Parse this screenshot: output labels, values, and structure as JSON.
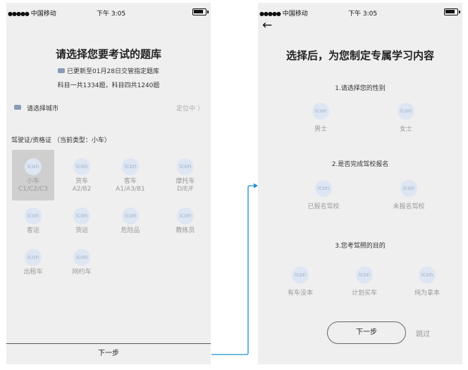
{
  "status_bar": {
    "signal_dots": "●●●●●",
    "carrier": "中国移动",
    "time": "下午 3:05"
  },
  "left_screen": {
    "title": "请选择您要考试的题库",
    "update_text": "已更新至01月28日交管指定题库",
    "total_text": "科目一共1334题，科目四共1240题",
    "city_label": "请选择城市",
    "locate_text": "定位中 〉",
    "license_section_title": "驾驶证/资格证 （当前类型：小车）",
    "categories": [
      {
        "icon": "icon",
        "name": "小车",
        "sub": "C1/C2/C3",
        "selected": true
      },
      {
        "icon": "icon",
        "name": "货车",
        "sub": "A2/B2"
      },
      {
        "icon": "icon",
        "name": "客车",
        "sub": "A1/A3/B1"
      },
      {
        "icon": "icon",
        "name": "摩托车",
        "sub": "D/E/F"
      },
      {
        "icon": "icon",
        "name": "客运"
      },
      {
        "icon": "icon",
        "name": "货运"
      },
      {
        "icon": "icon",
        "name": "危险品"
      },
      {
        "icon": "icon",
        "name": "教练员"
      },
      {
        "icon": "icon",
        "name": "出租车"
      },
      {
        "icon": "icon",
        "name": "网约车"
      }
    ],
    "next_label": "下一步"
  },
  "right_screen": {
    "back_arrow": "←",
    "title": "选择后，为您制定专属学习内容",
    "questions": [
      {
        "text": "1.请选择您的性别",
        "options": [
          {
            "icon": "icon",
            "label": "男士"
          },
          {
            "icon": "icon",
            "label": "女士"
          }
        ]
      },
      {
        "text": "2.是否完成驾校报名",
        "options": [
          {
            "icon": "icon",
            "label": "已报名驾校"
          },
          {
            "icon": "icon",
            "label": "未报名驾校"
          }
        ]
      },
      {
        "text": "3.您考驾照的目的",
        "options": [
          {
            "icon": "icon",
            "label": "有车没本"
          },
          {
            "icon": "icon",
            "label": "计划买车"
          },
          {
            "icon": "icon",
            "label": "纯为拿本"
          }
        ]
      }
    ],
    "next_label": "下一步",
    "skip_label": "跳过"
  },
  "colors": {
    "screen_bg": "#efefef",
    "icon_circle": "#dde6f2",
    "selected_bg": "#cfcfcf",
    "connector": "#1e90d0"
  }
}
